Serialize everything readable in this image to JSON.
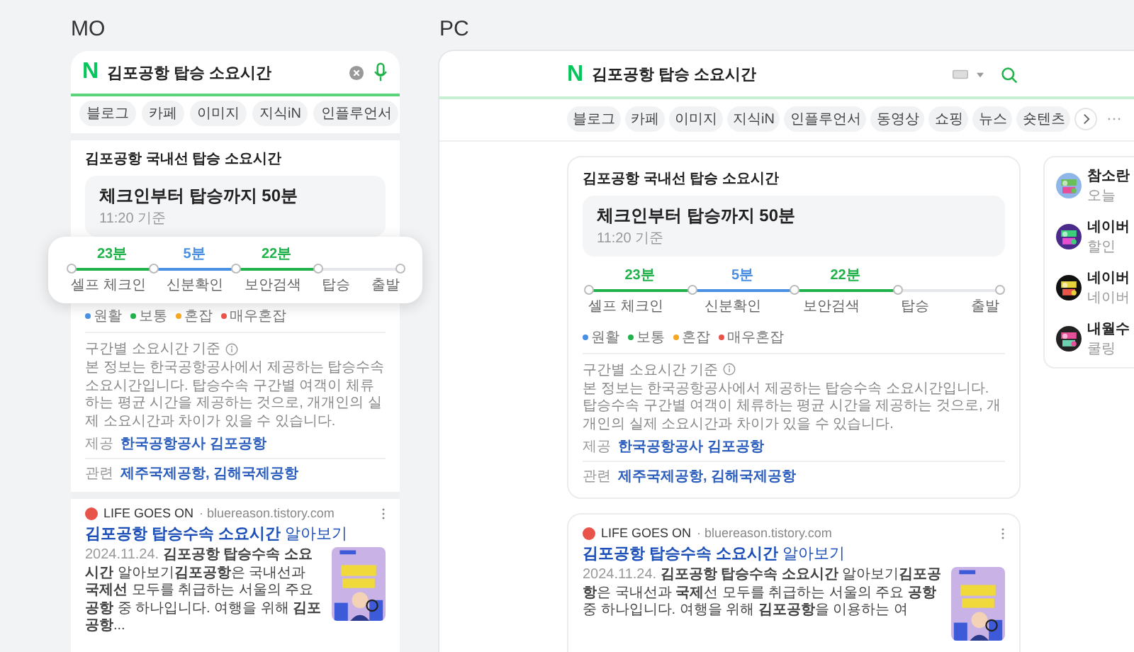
{
  "mobile": {
    "label": "MO",
    "logo": "N",
    "query": "김포공항 탑승 소요시간",
    "tabs": [
      "블로그",
      "카페",
      "이미지",
      "지식iN",
      "인플루언서"
    ],
    "card": {
      "title": "김포공항 국내선 탑승 소요시간",
      "headline": "체크인부터 탑승까지 50분",
      "time": "11:20 기준",
      "segments": [
        {
          "time": "23분",
          "color": "#22b24c"
        },
        {
          "time": "5분",
          "color": "#4a90e2"
        },
        {
          "time": "22분",
          "color": "#22b24c"
        }
      ],
      "stops": [
        "셀프 체크인",
        "신분확인",
        "보안검색",
        "탑승",
        "출발"
      ],
      "legend": [
        {
          "label": "원활",
          "color": "#4a90e2"
        },
        {
          "label": "보통",
          "color": "#22b24c"
        },
        {
          "label": "혼잡",
          "color": "#f5a623"
        },
        {
          "label": "매우혼잡",
          "color": "#e8534a"
        }
      ],
      "note_title": "구간별 소요시간 기준",
      "note": "본 정보는 한국공항공사에서 제공하는 탑승수속 소요시간입니다. 탑승수속 구간별 여객이 체류하는 평균 시간을 제공하는 것으로, 개개인의 실제 소요시간과 차이가 있을 수 있습니다.",
      "source_label": "제공",
      "source": "한국공항공사 김포공항",
      "related_label": "관련",
      "related": "제주국제공항, 김해국제공항"
    },
    "result": {
      "site": "LIFE GOES ON",
      "url": "· bluereason.tistory.com",
      "title": "**김포공항 탑승수속 소요시간** 알아보기",
      "date": "2024.11.24.",
      "snippet": "**김포공항 탑승수속 소요시간** 알아보기**김포공항**은 국내선과 **국제선** 모두를 취급하는 서울의 주요 **공항** 중 하나입니다. 여행을 위해 **김포공항**..."
    }
  },
  "pc": {
    "label": "PC",
    "logo": "N",
    "query": "김포공항 탑승 소요시간",
    "tabs": [
      "블로그",
      "카페",
      "이미지",
      "지식iN",
      "인플루언서",
      "동영상",
      "쇼핑",
      "뉴스",
      "숏텐츠"
    ],
    "card": {
      "title": "김포공항 국내선 탑승 소요시간",
      "headline": "체크인부터 탑승까지 50분",
      "time": "11:20 기준",
      "segments": [
        {
          "time": "23분",
          "color": "#22b24c"
        },
        {
          "time": "5분",
          "color": "#4a90e2"
        },
        {
          "time": "22분",
          "color": "#22b24c"
        }
      ],
      "stops": [
        "셀프 체크인",
        "신분확인",
        "보안검색",
        "탑승",
        "출발"
      ],
      "legend": [
        {
          "label": "원활",
          "color": "#4a90e2"
        },
        {
          "label": "보통",
          "color": "#22b24c"
        },
        {
          "label": "혼잡",
          "color": "#f5a623"
        },
        {
          "label": "매우혼잡",
          "color": "#e8534a"
        }
      ],
      "note_title": "구간별 소요시간 기준",
      "note": "본 정보는 한국공항공사에서 제공하는 탑승수속 소요시간입니다. 탑승수속 구간별 여객이 체류하는 평균 시간을 제공하는 것으로, 개개인의 실제 소요시간과 차이가 있을 수 있습니다.",
      "source_label": "제공",
      "source": "한국공항공사 김포공항",
      "related_label": "관련",
      "related": "제주국제공항, 김해국제공항"
    },
    "result": {
      "site": "LIFE GOES ON",
      "url": "· bluereason.tistory.com",
      "title": "**김포공항 탑승수속 소요시간** 알아보기",
      "date": "2024.11.24.",
      "snippet": "**김포공항 탑승수속 소요시간** 알아보기**김포공항**은 국내선과 **국제**선 모두를 취급하는 서울의 주요 **공항** 중 하나입니다. 여행을 위해 **김포공항**을 이용하는 여"
    },
    "side_items": [
      {
        "title": "참소란",
        "sub": "오늘"
      },
      {
        "title": "네이버",
        "sub": "할인"
      },
      {
        "title": "네이버",
        "sub": "네이버"
      },
      {
        "title": "내월수",
        "sub": "쿨링"
      }
    ]
  }
}
